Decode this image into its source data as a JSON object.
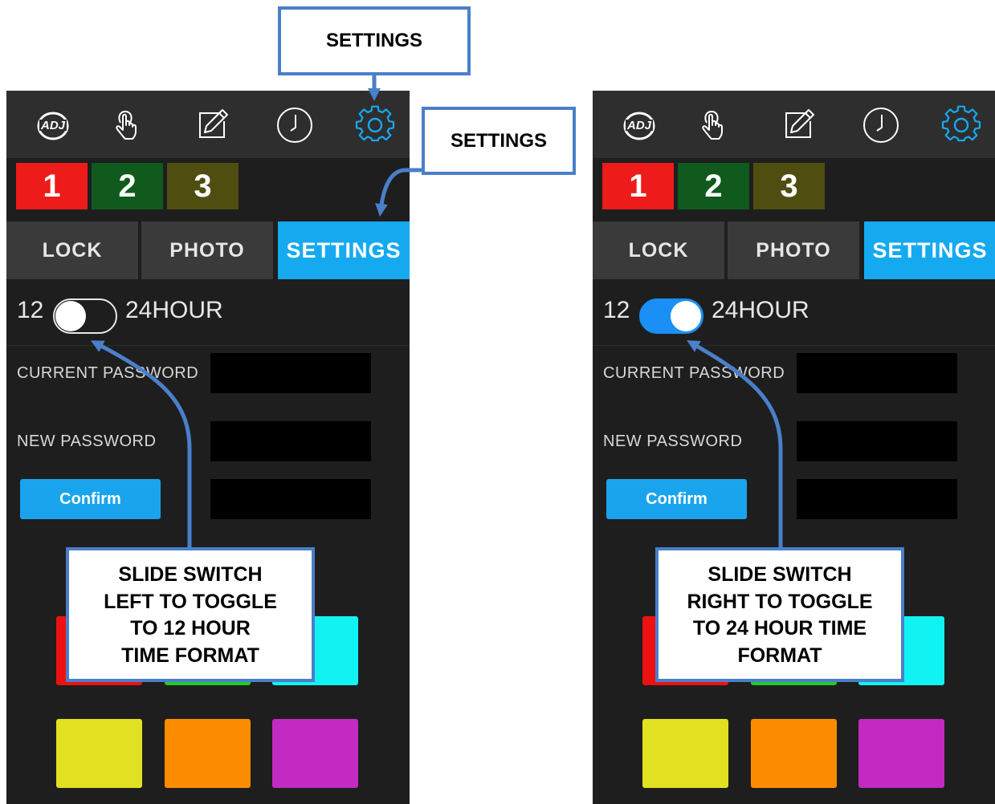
{
  "callouts": {
    "top_settings": "SETTINGS",
    "side_settings": "SETTINGS",
    "left_note": [
      "SLIDE SWITCH",
      "LEFT TO TOGGLE",
      "TO 12 HOUR",
      "TIME FORMAT"
    ],
    "right_note": [
      "SLIDE SWITCH",
      "RIGHT TO TOGGLE",
      "TO 24 HOUR TIME",
      "FORMAT"
    ]
  },
  "screens": [
    {
      "toolbar_icons": [
        "adj-logo-icon",
        "touch-hand-icon",
        "edit-pencil-icon",
        "clock-icon",
        "gear-icon"
      ],
      "presets": [
        {
          "label": "1",
          "color": "#ee1b1b"
        },
        {
          "label": "2",
          "color": "#0f5a1c"
        },
        {
          "label": "3",
          "color": "#4f4d10"
        }
      ],
      "tabs": [
        {
          "label": "LOCK",
          "active": false
        },
        {
          "label": "PHOTO",
          "active": false
        },
        {
          "label": "SETTINGS",
          "active": true
        }
      ],
      "toggle": {
        "left_label": "12",
        "right_label": "24HOUR",
        "on": false
      },
      "fields": {
        "current_password_label": "CURRENT PASSWORD",
        "new_password_label": "NEW PASSWORD"
      },
      "confirm_label": "Confirm",
      "swatch_colors": [
        "#ee1111",
        "#22cc22",
        "#11f2f2",
        "#e1e121",
        "#fb8c00",
        "#c22ac2"
      ]
    },
    {
      "toolbar_icons": [
        "adj-logo-icon",
        "touch-hand-icon",
        "edit-pencil-icon",
        "clock-icon",
        "gear-icon"
      ],
      "presets": [
        {
          "label": "1",
          "color": "#ee1b1b"
        },
        {
          "label": "2",
          "color": "#0f5a1c"
        },
        {
          "label": "3",
          "color": "#4f4d10"
        }
      ],
      "tabs": [
        {
          "label": "LOCK",
          "active": false
        },
        {
          "label": "PHOTO",
          "active": false
        },
        {
          "label": "SETTINGS",
          "active": true
        }
      ],
      "toggle": {
        "left_label": "12",
        "right_label": "24HOUR",
        "on": true
      },
      "fields": {
        "current_password_label": "CURRENT PASSWORD",
        "new_password_label": "NEW PASSWORD"
      },
      "confirm_label": "Confirm",
      "swatch_colors": [
        "#ee1111",
        "#22cc22",
        "#11f2f2",
        "#e1e121",
        "#fb8c00",
        "#c22ac2"
      ]
    }
  ],
  "colors": {
    "accent": "#15aaf0",
    "callout_border": "#4a7fc9",
    "toggle_on": "#1a8ff5"
  }
}
